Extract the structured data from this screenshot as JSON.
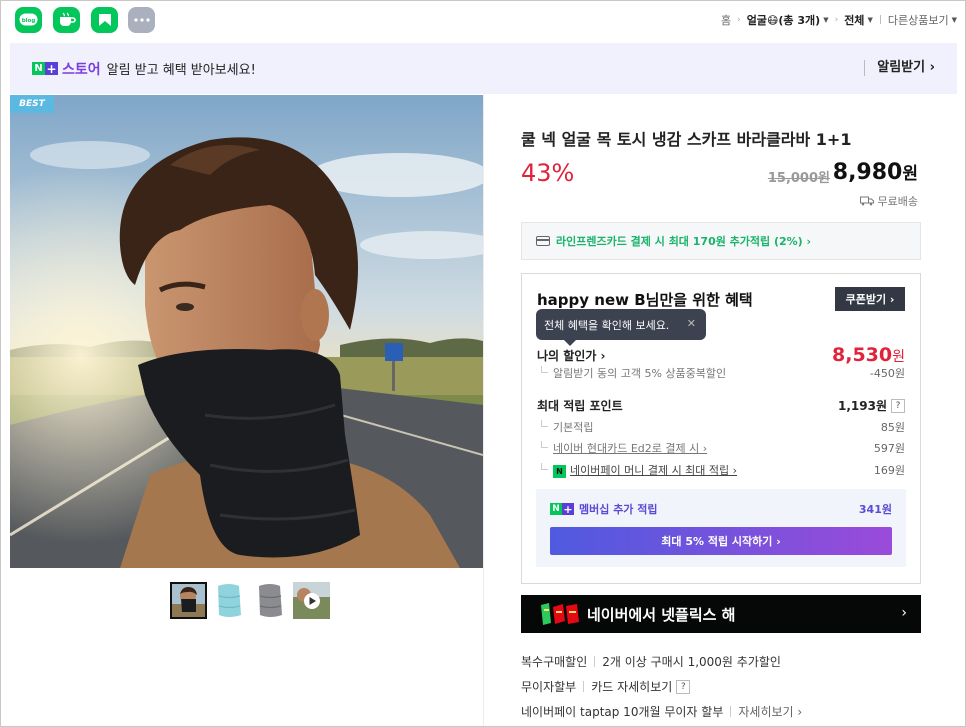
{
  "topbar": {
    "apps": [
      {
        "icon": "blog-icon",
        "label": "blog"
      },
      {
        "icon": "cafe-icon",
        "label": ""
      },
      {
        "icon": "bookmark-icon",
        "label": ""
      },
      {
        "icon": "more-icon",
        "label": "···"
      }
    ],
    "breadcrumb": {
      "home": "홈",
      "category": "얼굴😷(총 3개)",
      "filter": "전체",
      "other": "다른상품보기"
    }
  },
  "banner": {
    "brand": "스토어",
    "message": "알림 받고 혜택 받아보세요!",
    "action": "알림받기 ›"
  },
  "product": {
    "badge": "BEST",
    "title": "쿨 넥 얼굴 목 토시 냉감 스카프 바라클라바 1+1",
    "discount": "43%",
    "original_price": "15,000원",
    "price": "8,980",
    "price_unit": "원",
    "shipping": "무료배송",
    "card_offer": "라인프렌즈카드 결제 시 최대 170원 추가적립 (2%) ›"
  },
  "benefit": {
    "title": "happy new B님만을 위한 혜택",
    "coupon_button": "쿠폰받기 ›",
    "tooltip": "전체 혜택을 확인해 보세요.",
    "my_discount_label": "나의 할인가 ›",
    "my_discount_value": "8,530",
    "my_discount_unit": "원",
    "alarm_discount_label": "알림받기 동의 고객 5% 상품중복할인",
    "alarm_discount_value": "-450원",
    "max_point_label": "최대 적립 포인트",
    "max_point_value": "1,193원",
    "help": "?",
    "base_point_label": "기본적립",
    "base_point_value": "85원",
    "hyundai_label": "네이버 현대카드 Ed2로 결제 시 ›",
    "hyundai_value": "597원",
    "npay_label": "네이버페이 머니 결제 시 최대 적립 ›",
    "npay_badge": "N",
    "npay_value": "169원",
    "member_label": "멤버십 추가 적립",
    "member_value": "341원",
    "member_button": "최대 5% 적립 시작하기 ›"
  },
  "netflix_banner": {
    "text": "네이버에서 넷플릭스 해",
    "arrow": "›"
  },
  "extra_info": {
    "multi_buy_label": "복수구매할인",
    "multi_buy_value": "2개 이상 구매시 1,000원 추가할인",
    "installment_label": "무이자할부",
    "installment_value": "카드 자세히보기",
    "taptap_label": "네이버페이 taptap 10개월 무이자 할부",
    "taptap_link": "자세히보기 ›"
  }
}
